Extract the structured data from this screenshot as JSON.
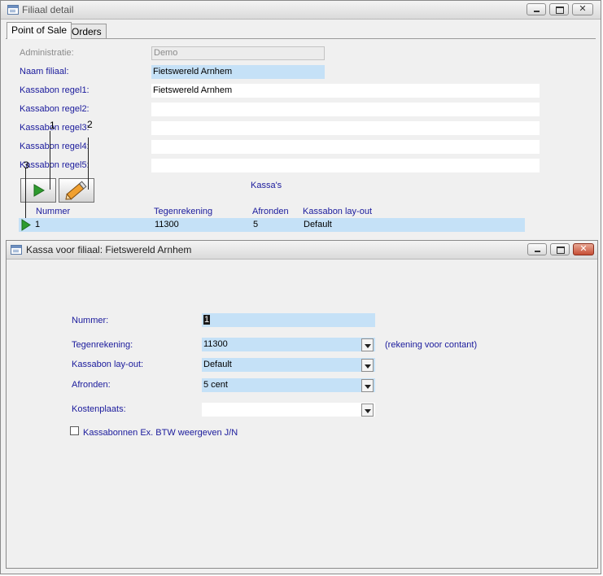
{
  "main_window": {
    "title": "Filiaal detail",
    "tabs": [
      {
        "label": "Point of Sale",
        "active": true
      },
      {
        "label": "Orders",
        "active": false
      }
    ],
    "fields": {
      "administratie": {
        "label": "Administratie:",
        "value": "Demo"
      },
      "naam_filiaal": {
        "label": "Naam filiaal:",
        "value": "Fietswereld Arnhem"
      },
      "kassabon_regel1": {
        "label": "Kassabon regel1:",
        "value": "Fietswereld Arnhem"
      },
      "kassabon_regel2": {
        "label": "Kassabon regel2:",
        "value": ""
      },
      "kassabon_regel3": {
        "label": "Kassabon regel3:",
        "value": ""
      },
      "kassabon_regel4": {
        "label": "Kassabon regel4:",
        "value": ""
      },
      "kassabon_regel5": {
        "label": "Kassabon regel5:",
        "value": ""
      }
    },
    "callouts": [
      "1",
      "2",
      "3"
    ],
    "subform": {
      "title": "Kassa's",
      "columns": [
        "Nummer",
        "Tegenrekening",
        "Afronden",
        "Kassabon lay-out"
      ],
      "rows": [
        {
          "nummer": "1",
          "tegenrekening": "11300",
          "afronden": "5",
          "layout": "Default"
        }
      ]
    }
  },
  "kassa_window": {
    "title": "Kassa voor filiaal: Fietswereld Arnhem",
    "fields": {
      "nummer": {
        "label": "Nummer:",
        "value": "1"
      },
      "tegenrekening": {
        "label": "Tegenrekening:",
        "value": "11300",
        "hint": "(rekening voor contant)"
      },
      "layout": {
        "label": "Kassabon lay-out:",
        "value": "Default"
      },
      "afronden": {
        "label": "Afronden:",
        "value": "5 cent"
      },
      "kostenplaats": {
        "label": "Kostenplaats:",
        "value": ""
      }
    },
    "checkbox": {
      "label": "Kassabonnen Ex. BTW weergeven J/N",
      "checked": false
    }
  },
  "icons": {
    "play": "play-arrow-icon",
    "edit": "pencil-icon",
    "record_selector": "record-pointer-icon"
  },
  "colors": {
    "label_text": "#1a1a9c",
    "field_highlight": "#c5e1f7",
    "play_green": "#2e9b2e",
    "close_red": "#c64d35"
  }
}
